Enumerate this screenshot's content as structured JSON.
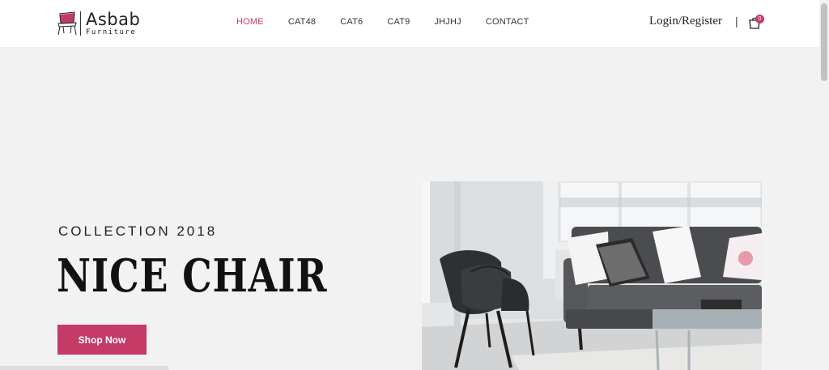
{
  "brand": {
    "name": "Asbab",
    "tagline": "Furniture",
    "accent": "#c43b68"
  },
  "nav": {
    "items": [
      {
        "label": "HOME",
        "active": true
      },
      {
        "label": "CAT48",
        "active": false
      },
      {
        "label": "CAT6",
        "active": false
      },
      {
        "label": "CAT9",
        "active": false
      },
      {
        "label": "JHJHJ",
        "active": false
      },
      {
        "label": "CONTACT",
        "active": false
      }
    ]
  },
  "header": {
    "login_label": "Login/Register",
    "separator": "|",
    "cart_count": "0",
    "cart_icon": "shopping-bag-icon"
  },
  "hero": {
    "subtitle": "COLLECTION 2018",
    "title": "NICE CHAIR",
    "cta_label": "Shop Now",
    "image": "living-room-chair-sofa-photo"
  }
}
